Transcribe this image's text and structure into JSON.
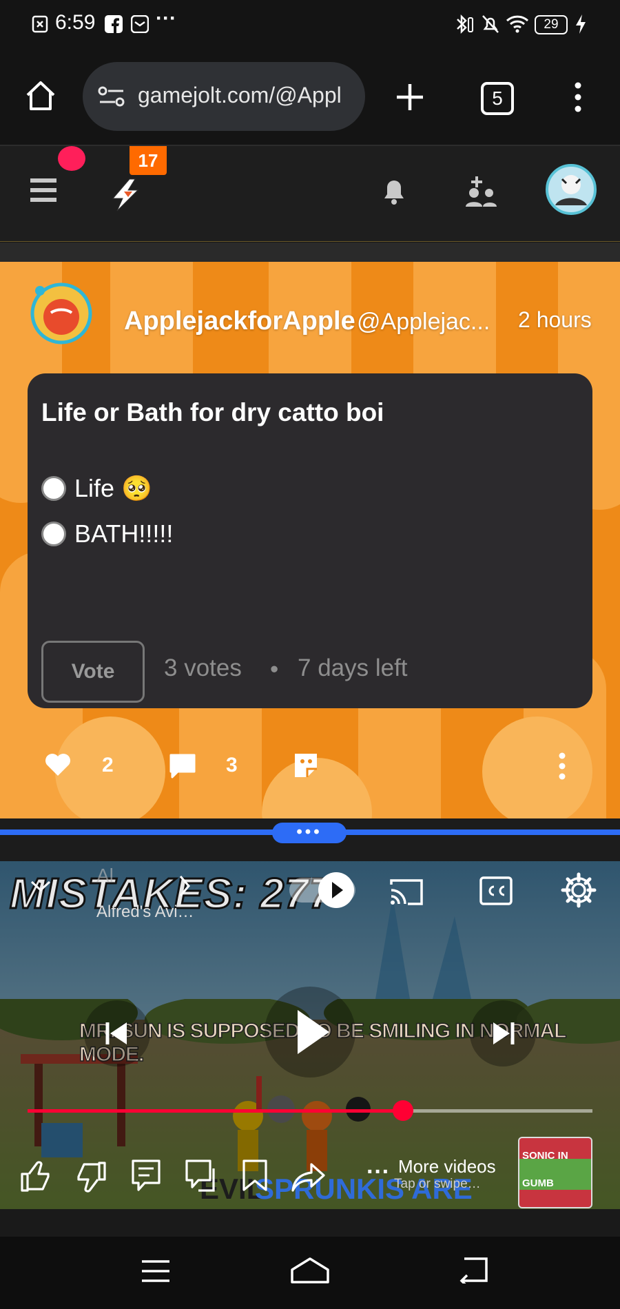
{
  "status_bar": {
    "time": "6:59",
    "battery": "29"
  },
  "browser": {
    "url": "gamejolt.com/@Appl",
    "tab_count": "5"
  },
  "gamejolt_nav": {
    "notification_badge": "17"
  },
  "post": {
    "author_name": "ApplejackforApple",
    "author_handle": "@Applejac...",
    "timestamp": "2 hours",
    "poll": {
      "title": "Life or Bath for dry catto boi",
      "options": [
        {
          "label": "Life 🥺"
        },
        {
          "label": "BATH!!!!!"
        }
      ],
      "vote_label": "Vote",
      "votes": "3 votes",
      "separator": "•",
      "time_left": "7 days left"
    },
    "likes": "2",
    "comments": "3"
  },
  "video": {
    "overlay_text": "MISTAKES: 277",
    "channel_partial": "Al",
    "channel": "Alfred's Avi…",
    "subtitle": "MR. SUN IS SUPPOSED TO BE SMILING IN NORMAL MODE.",
    "bottom_text_a": "EVIL",
    "bottom_text_b": "SPRUNKIS ARE",
    "progress": 0.665,
    "more_videos": "More videos",
    "more_videos_sub": "Tap or swipe…",
    "thumbnail_text": "SONIC IN GUMB"
  },
  "colors": {
    "accent_blue": "#2d6cf6",
    "progress_red": "#ff0033",
    "badge_orange": "#ff6a00",
    "notify_pink": "#ff1f5a"
  }
}
